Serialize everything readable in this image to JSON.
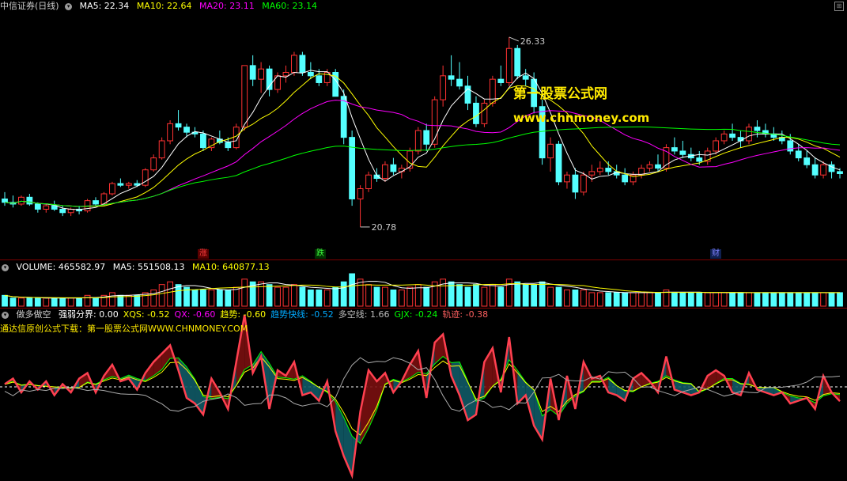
{
  "main": {
    "title": "中信证券(日线)",
    "ma": [
      {
        "label": "MA5: 22.34",
        "color": "#ffffff"
      },
      {
        "label": "MA10: 22.64",
        "color": "#ffff00"
      },
      {
        "label": "MA20: 23.11",
        "color": "#ff00ff"
      },
      {
        "label": "MA60: 23.14",
        "color": "#00ff00"
      }
    ],
    "high_label": "26.33",
    "low_label": "20.78",
    "tags": [
      {
        "text": "涨",
        "color": "#ff4040",
        "bg": "#5a0000"
      },
      {
        "text": "跌",
        "color": "#40ff40",
        "bg": "#003300"
      },
      {
        "text": "财",
        "color": "#8080ff",
        "bg": "#102050"
      }
    ]
  },
  "volume": {
    "label": "VOLUME: 465582.97",
    "ma5": "MA5: 551508.13",
    "ma10": "MA10: 640877.13"
  },
  "indicator": {
    "name": "做多做空",
    "items": [
      {
        "label": "强弱分界: 0.00",
        "color": "#ffffff"
      },
      {
        "label": "XQS: -0.52",
        "color": "#ffff00"
      },
      {
        "label": "QX: -0.60",
        "color": "#ff00ff"
      },
      {
        "label": "趋势: -0.60",
        "color": "#ffff00"
      },
      {
        "label": "趋势快线: -0.52",
        "color": "#00aaff"
      },
      {
        "label": "多空线: 1.66",
        "color": "#bbbbbb"
      },
      {
        "label": "GJX: -0.24",
        "color": "#00ff00"
      },
      {
        "label": "轨迹: -0.38",
        "color": "#ff6060"
      }
    ],
    "download_text": "通达信原创公式下载：第一股票公式网WWW.CHNMONEY.COM"
  },
  "watermark": {
    "line1": "第一股票公式网",
    "line2": "www.chnmoney.com"
  },
  "colors": {
    "up": "#ff3232",
    "down": "#54ffff",
    "ma5": "#ffffff",
    "ma10": "#ffff00",
    "ma20": "#ff00ff",
    "ma60": "#00ff00"
  },
  "chart_data": {
    "type": "candlestick",
    "ylim": [
      20.2,
      27.0
    ],
    "candles": [
      [
        21.6,
        21.8,
        21.4,
        21.5
      ],
      [
        21.5,
        21.7,
        21.35,
        21.45
      ],
      [
        21.45,
        21.7,
        21.4,
        21.65
      ],
      [
        21.65,
        21.75,
        21.4,
        21.45
      ],
      [
        21.45,
        21.5,
        21.2,
        21.3
      ],
      [
        21.3,
        21.45,
        21.2,
        21.4
      ],
      [
        21.4,
        21.55,
        21.25,
        21.3
      ],
      [
        21.3,
        21.4,
        21.1,
        21.2
      ],
      [
        21.2,
        21.35,
        21.1,
        21.3
      ],
      [
        21.3,
        21.4,
        21.15,
        21.25
      ],
      [
        21.25,
        21.6,
        21.2,
        21.55
      ],
      [
        21.55,
        21.65,
        21.4,
        21.45
      ],
      [
        21.45,
        21.8,
        21.4,
        21.75
      ],
      [
        21.75,
        22.1,
        21.7,
        22.05
      ],
      [
        22.05,
        22.2,
        21.95,
        22.0
      ],
      [
        22.0,
        22.1,
        21.9,
        22.05
      ],
      [
        22.05,
        22.15,
        21.95,
        22.0
      ],
      [
        22.0,
        22.5,
        21.95,
        22.45
      ],
      [
        22.45,
        22.9,
        22.4,
        22.8
      ],
      [
        22.8,
        23.4,
        22.75,
        23.3
      ],
      [
        23.3,
        23.9,
        23.2,
        23.8
      ],
      [
        23.8,
        24.2,
        23.6,
        23.7
      ],
      [
        23.7,
        23.8,
        23.4,
        23.55
      ],
      [
        23.55,
        23.7,
        23.4,
        23.5
      ],
      [
        23.5,
        23.6,
        23.0,
        23.1
      ],
      [
        23.1,
        23.4,
        23.0,
        23.35
      ],
      [
        23.35,
        23.6,
        23.2,
        23.25
      ],
      [
        23.25,
        23.4,
        23.0,
        23.1
      ],
      [
        23.1,
        23.8,
        23.05,
        23.7
      ],
      [
        23.7,
        24.6,
        23.6,
        25.5
      ],
      [
        25.5,
        25.8,
        24.9,
        25.1
      ],
      [
        25.1,
        25.6,
        24.7,
        25.4
      ],
      [
        25.4,
        25.5,
        24.6,
        24.8
      ],
      [
        24.8,
        25.3,
        24.7,
        25.2
      ],
      [
        25.2,
        25.5,
        25.0,
        25.3
      ],
      [
        25.3,
        25.9,
        25.2,
        25.8
      ],
      [
        25.8,
        25.9,
        25.2,
        25.3
      ],
      [
        25.3,
        25.6,
        25.1,
        25.2
      ],
      [
        25.2,
        25.4,
        24.9,
        25.0
      ],
      [
        25.0,
        25.4,
        24.9,
        25.3
      ],
      [
        25.3,
        25.4,
        24.6,
        24.6
      ],
      [
        24.6,
        24.8,
        23.2,
        23.4
      ],
      [
        23.4,
        23.6,
        21.4,
        21.6
      ],
      [
        21.6,
        22.0,
        20.78,
        21.9
      ],
      [
        21.9,
        22.4,
        21.8,
        22.3
      ],
      [
        22.3,
        22.5,
        22.1,
        22.2
      ],
      [
        22.2,
        22.7,
        22.1,
        22.6
      ],
      [
        22.6,
        22.8,
        22.3,
        22.4
      ],
      [
        22.4,
        22.6,
        22.2,
        22.5
      ],
      [
        22.5,
        23.1,
        22.4,
        23.0
      ],
      [
        23.0,
        23.7,
        22.9,
        23.6
      ],
      [
        23.6,
        23.8,
        23.0,
        23.2
      ],
      [
        23.2,
        24.6,
        23.1,
        24.5
      ],
      [
        24.5,
        25.5,
        24.3,
        25.2
      ],
      [
        25.2,
        25.8,
        24.9,
        25.1
      ],
      [
        25.1,
        25.6,
        24.8,
        24.9
      ],
      [
        24.9,
        25.2,
        24.2,
        24.4
      ],
      [
        24.4,
        24.6,
        23.7,
        23.8
      ],
      [
        23.8,
        24.5,
        23.7,
        24.4
      ],
      [
        24.4,
        25.2,
        24.3,
        25.1
      ],
      [
        25.1,
        25.5,
        24.9,
        25.0
      ],
      [
        25.0,
        26.33,
        24.9,
        26.0
      ],
      [
        26.0,
        26.1,
        25.1,
        25.2
      ],
      [
        25.2,
        25.4,
        24.9,
        25.1
      ],
      [
        25.1,
        25.3,
        24.1,
        24.3
      ],
      [
        24.3,
        24.5,
        22.6,
        22.8
      ],
      [
        22.8,
        23.4,
        22.4,
        23.2
      ],
      [
        23.2,
        23.3,
        22.0,
        22.1
      ],
      [
        22.1,
        22.4,
        21.9,
        22.3
      ],
      [
        22.3,
        22.5,
        21.6,
        21.8
      ],
      [
        21.8,
        22.4,
        21.7,
        22.3
      ],
      [
        22.3,
        22.6,
        22.1,
        22.4
      ],
      [
        22.4,
        22.7,
        22.3,
        22.5
      ],
      [
        22.5,
        22.7,
        22.3,
        22.4
      ],
      [
        22.4,
        22.6,
        22.2,
        22.3
      ],
      [
        22.3,
        22.5,
        22.0,
        22.1
      ],
      [
        22.1,
        22.4,
        22.0,
        22.3
      ],
      [
        22.3,
        22.6,
        22.2,
        22.5
      ],
      [
        22.5,
        22.7,
        22.4,
        22.6
      ],
      [
        22.6,
        22.9,
        22.4,
        22.5
      ],
      [
        22.5,
        23.2,
        22.4,
        23.1
      ],
      [
        23.1,
        23.4,
        22.9,
        23.0
      ],
      [
        23.0,
        23.3,
        22.8,
        22.9
      ],
      [
        22.9,
        23.1,
        22.7,
        22.8
      ],
      [
        22.8,
        23.0,
        22.6,
        22.7
      ],
      [
        22.7,
        23.1,
        22.6,
        23.0
      ],
      [
        23.0,
        23.4,
        22.9,
        23.3
      ],
      [
        23.3,
        23.6,
        23.2,
        23.5
      ],
      [
        23.5,
        23.8,
        23.3,
        23.4
      ],
      [
        23.4,
        23.6,
        23.1,
        23.3
      ],
      [
        23.3,
        23.8,
        23.2,
        23.7
      ],
      [
        23.7,
        23.9,
        23.4,
        23.6
      ],
      [
        23.6,
        23.8,
        23.4,
        23.5
      ],
      [
        23.5,
        23.7,
        23.3,
        23.4
      ],
      [
        23.4,
        23.6,
        23.2,
        23.3
      ],
      [
        23.3,
        23.5,
        22.9,
        23.0
      ],
      [
        23.0,
        23.2,
        22.7,
        22.8
      ],
      [
        22.8,
        23.0,
        22.5,
        22.6
      ],
      [
        22.6,
        22.8,
        22.2,
        22.3
      ],
      [
        22.3,
        22.7,
        22.2,
        22.6
      ],
      [
        22.6,
        22.7,
        22.2,
        22.4
      ],
      [
        22.4,
        22.5,
        22.2,
        22.34
      ]
    ],
    "volume": [
      4,
      3,
      3,
      3,
      3,
      3,
      3,
      3,
      3,
      3,
      4,
      3,
      4,
      5,
      4,
      4,
      4,
      5,
      6,
      8,
      9,
      8,
      7,
      6,
      6,
      6,
      6,
      6,
      7,
      10,
      9,
      9,
      8,
      7,
      7,
      8,
      7,
      6,
      6,
      6,
      7,
      9,
      12,
      10,
      8,
      7,
      7,
      6,
      6,
      7,
      8,
      7,
      9,
      10,
      9,
      8,
      7,
      8,
      7,
      8,
      7,
      10,
      9,
      8,
      8,
      9,
      7,
      7,
      6,
      6,
      6,
      5,
      5,
      5,
      5,
      5,
      5,
      5,
      5,
      5,
      6,
      5,
      5,
      5,
      5,
      5,
      5,
      5,
      5,
      5,
      5,
      5,
      5,
      5,
      5,
      5,
      5,
      5,
      5,
      5,
      5,
      5
    ],
    "indicator": [
      0.1,
      0.3,
      -0.2,
      0.2,
      -0.1,
      0.2,
      -0.3,
      0.1,
      -0.2,
      0.3,
      0.5,
      -0.2,
      0.4,
      0.8,
      0.2,
      0.3,
      -0.1,
      0.5,
      0.9,
      1.2,
      1.5,
      0.6,
      -0.4,
      -0.6,
      -1.0,
      0.3,
      -0.2,
      -0.8,
      0.9,
      2.6,
      0.5,
      1.1,
      -0.8,
      0.6,
      0.4,
      0.9,
      -0.3,
      -0.2,
      -0.5,
      0.2,
      -1.6,
      -2.5,
      -3.2,
      -0.9,
      0.6,
      0.2,
      0.5,
      -0.2,
      0.2,
      0.8,
      1.3,
      -0.4,
      1.6,
      1.9,
      0.4,
      -0.3,
      -1.2,
      -1.0,
      0.9,
      1.4,
      -0.2,
      1.8,
      -0.6,
      -0.3,
      -1.4,
      -1.9,
      0.3,
      -1.2,
      0.4,
      -0.8,
      0.9,
      0.3,
      0.4,
      -0.2,
      -0.3,
      -0.5,
      0.3,
      0.5,
      0.2,
      -0.2,
      1.1,
      -0.1,
      -0.2,
      -0.3,
      -0.2,
      0.4,
      0.6,
      0.4,
      -0.2,
      -0.3,
      0.5,
      -0.1,
      -0.2,
      -0.3,
      -0.2,
      -0.6,
      -0.5,
      -0.4,
      -0.8,
      0.4,
      -0.2,
      -0.52
    ]
  }
}
